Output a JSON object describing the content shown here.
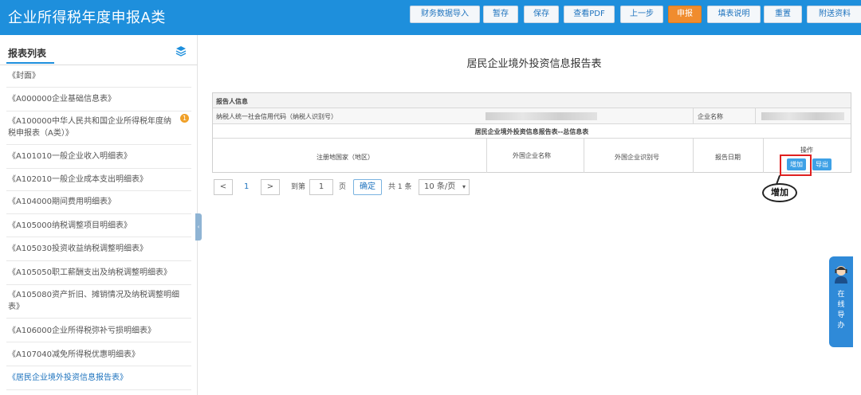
{
  "header": {
    "title": "企业所得税年度申报A类",
    "buttons": [
      "财务数据导入",
      "暂存",
      "保存",
      "查看PDF",
      "上一步",
      "申报",
      "填表说明",
      "重置",
      "附送资料"
    ],
    "active_button": "申报"
  },
  "sidebar": {
    "title": "报表列表",
    "items": [
      {
        "label": "《封面》"
      },
      {
        "label": "《A000000企业基础信息表》"
      },
      {
        "label": "《A100000中华人民共和国企业所得税年度纳税申报表（A类）》",
        "badge": "1"
      },
      {
        "label": "《A101010一般企业收入明细表》"
      },
      {
        "label": "《A102010一般企业成本支出明细表》"
      },
      {
        "label": "《A104000期间费用明细表》"
      },
      {
        "label": "《A105000纳税调整项目明细表》"
      },
      {
        "label": "《A105030投资收益纳税调整明细表》"
      },
      {
        "label": "《A105050职工薪酬支出及纳税调整明细表》"
      },
      {
        "label": "《A105080资产折旧、摊销情况及纳税调整明细表》"
      },
      {
        "label": "《A106000企业所得税弥补亏损明细表》"
      },
      {
        "label": "《A107040减免所得税优惠明细表》"
      },
      {
        "label": "《居民企业境外投资信息报告表》"
      }
    ],
    "collapse_glyph": "‹"
  },
  "report": {
    "title": "居民企业境外投资信息报告表",
    "section_taxpayer": "报告人信息",
    "taxpayer_id_label": "纳税人统一社会信用代码（纳税人识别号）",
    "company_name_label": "企业名称",
    "summary_title": "居民企业境外投资信息报告表--总信息表",
    "columns": [
      "注册地国家（地区）",
      "外国企业名称",
      "外国企业识别号",
      "报告日期",
      "操作"
    ],
    "add_button": "增加",
    "export_button": "导出"
  },
  "pager": {
    "prev": "<",
    "current_page": "1",
    "next": ">",
    "goto_label": "到第",
    "goto_value": "1",
    "page_unit": "页",
    "confirm": "确定",
    "total": "共 1 条",
    "page_size": "10 条/页",
    "page_size_arrow": "▾"
  },
  "callout": {
    "text": "增加"
  },
  "help": {
    "text": "在线导办"
  }
}
